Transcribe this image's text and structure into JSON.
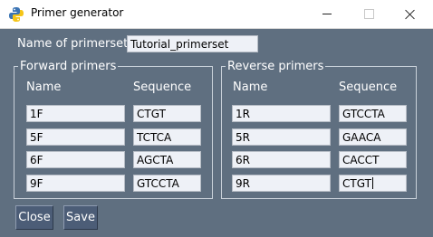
{
  "window": {
    "title": "Primer generator",
    "icon": "python-icon"
  },
  "primerset": {
    "label": "Name of primerset:",
    "value": "Tutorial_primerset"
  },
  "forward": {
    "title": "Forward primers",
    "name_header": "Name",
    "sequence_header": "Sequence",
    "rows": [
      {
        "name": "1F",
        "sequence": "CTGT"
      },
      {
        "name": "5F",
        "sequence": "TCTCA"
      },
      {
        "name": "6F",
        "sequence": "AGCTA"
      },
      {
        "name": "9F",
        "sequence": "GTCCTA"
      }
    ]
  },
  "reverse": {
    "title": "Reverse primers",
    "name_header": "Name",
    "sequence_header": "Sequence",
    "rows": [
      {
        "name": "1R",
        "sequence": "GTCCTA"
      },
      {
        "name": "5R",
        "sequence": "GAACA"
      },
      {
        "name": "6R",
        "sequence": "CACCT"
      },
      {
        "name": "9R",
        "sequence": "CTGT"
      }
    ]
  },
  "buttons": {
    "close": "Close",
    "save": "Save"
  },
  "colors": {
    "background": "#5f6f80",
    "button": "#4c5d77",
    "entry": "#eef1f7"
  }
}
